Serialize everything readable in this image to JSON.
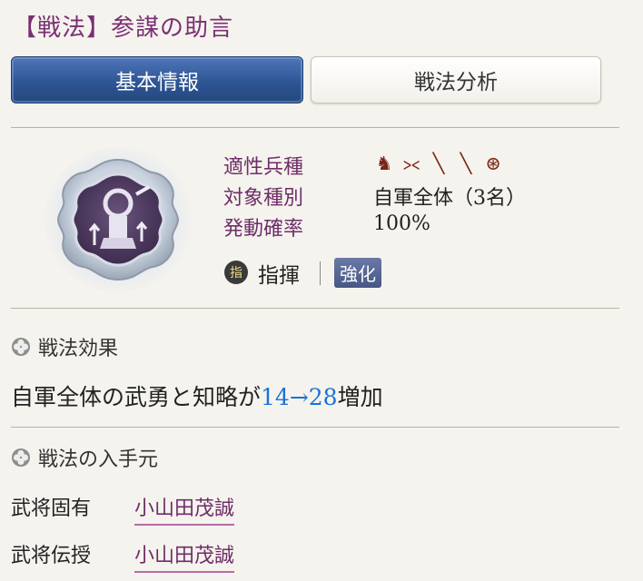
{
  "header": {
    "title": "【戦法】参謀の助言"
  },
  "tabs": [
    {
      "label": "基本情報",
      "active": true
    },
    {
      "label": "戦法分析",
      "active": false
    }
  ],
  "info": {
    "troop_label": "適性兵種",
    "troop_icons": [
      "cavalry-icon",
      "bow-icon",
      "gun-icon",
      "spear-icon",
      "wheel-icon"
    ],
    "target_label": "対象種別",
    "target_value": "自軍全体（3名）",
    "rate_label": "発動確率",
    "rate_value": "100%",
    "type_badge": "指",
    "type_label": "指揮",
    "enhance_label": "強化"
  },
  "effect": {
    "heading": "戦法効果",
    "text_prefix": "自軍全体の武勇と知略が",
    "text_highlight": "14→28",
    "text_suffix": "増加",
    "highlight_color": "#1a73d9"
  },
  "source": {
    "heading": "戦法の入手元",
    "rows": [
      {
        "label": "武将固有",
        "name": "小山田茂誠"
      },
      {
        "label": "武将伝授",
        "name": "小山田茂誠"
      }
    ]
  },
  "colors": {
    "accent_purple": "#6e2e68",
    "tab_blue": "#2e5594"
  }
}
